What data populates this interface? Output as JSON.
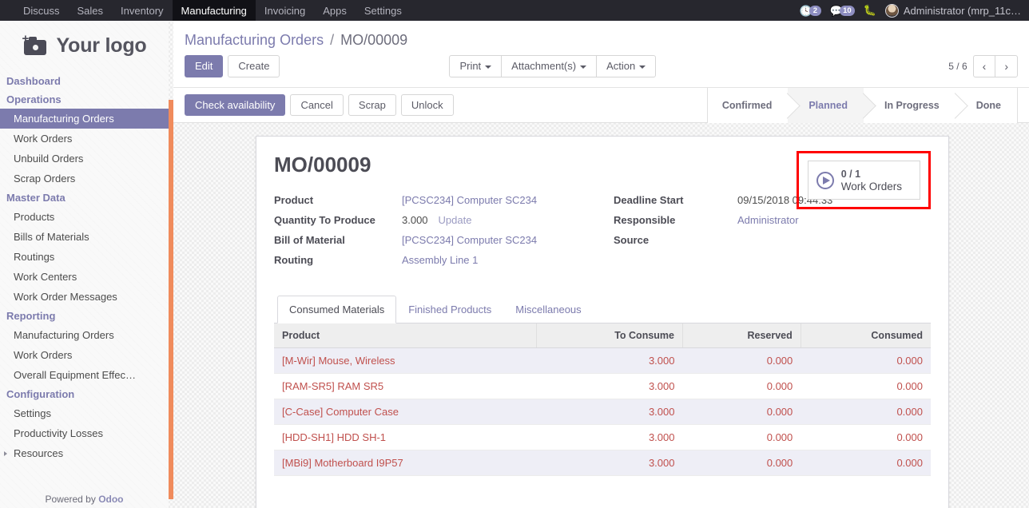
{
  "navbar": {
    "items": [
      {
        "label": "Discuss",
        "active": false
      },
      {
        "label": "Sales",
        "active": false
      },
      {
        "label": "Inventory",
        "active": false
      },
      {
        "label": "Manufacturing",
        "active": true
      },
      {
        "label": "Invoicing",
        "active": false
      },
      {
        "label": "Apps",
        "active": false
      },
      {
        "label": "Settings",
        "active": false
      }
    ],
    "activity_count": "2",
    "messages_count": "10",
    "user_name": "Administrator (mrp_11c…"
  },
  "sidebar": {
    "logo_text": "Your logo",
    "sections": [
      {
        "header": "Dashboard",
        "items": []
      },
      {
        "header": "Operations",
        "items": [
          {
            "label": "Manufacturing Orders",
            "active": true,
            "expandable": false
          },
          {
            "label": "Work Orders",
            "active": false,
            "expandable": false
          },
          {
            "label": "Unbuild Orders",
            "active": false,
            "expandable": false
          },
          {
            "label": "Scrap Orders",
            "active": false,
            "expandable": false
          }
        ]
      },
      {
        "header": "Master Data",
        "items": [
          {
            "label": "Products",
            "active": false,
            "expandable": false
          },
          {
            "label": "Bills of Materials",
            "active": false,
            "expandable": false
          },
          {
            "label": "Routings",
            "active": false,
            "expandable": false
          },
          {
            "label": "Work Centers",
            "active": false,
            "expandable": false
          },
          {
            "label": "Work Order Messages",
            "active": false,
            "expandable": false
          }
        ]
      },
      {
        "header": "Reporting",
        "items": [
          {
            "label": "Manufacturing Orders",
            "active": false,
            "expandable": false
          },
          {
            "label": "Work Orders",
            "active": false,
            "expandable": false
          },
          {
            "label": "Overall Equipment Effec…",
            "active": false,
            "expandable": false
          }
        ]
      },
      {
        "header": "Configuration",
        "items": [
          {
            "label": "Settings",
            "active": false,
            "expandable": false
          },
          {
            "label": "Productivity Losses",
            "active": false,
            "expandable": false
          },
          {
            "label": "Resources",
            "active": false,
            "expandable": true
          }
        ]
      }
    ],
    "powered_prefix": "Powered by ",
    "powered_brand": "Odoo"
  },
  "control_panel": {
    "breadcrumb_root": "Manufacturing Orders",
    "breadcrumb_sep": "/",
    "breadcrumb_current": "MO/00009",
    "edit_label": "Edit",
    "create_label": "Create",
    "print_label": "Print",
    "attachments_label": "Attachment(s)",
    "action_label": "Action",
    "pager_text": "5 / 6",
    "prev_glyph": "‹",
    "next_glyph": "›"
  },
  "statusbar": {
    "buttons": [
      {
        "label": "Check availability",
        "primary": true
      },
      {
        "label": "Cancel",
        "primary": false
      },
      {
        "label": "Scrap",
        "primary": false
      },
      {
        "label": "Unlock",
        "primary": false
      }
    ],
    "stages": [
      {
        "label": "Confirmed",
        "active": false
      },
      {
        "label": "Planned",
        "active": true
      },
      {
        "label": "In Progress",
        "active": false
      },
      {
        "label": "Done",
        "active": false
      }
    ]
  },
  "form": {
    "title": "MO/00009",
    "stat_button": {
      "value": "0 / 1",
      "label": "Work Orders",
      "icon": "play-circle-icon",
      "highlight_color": "#ff0000"
    },
    "left_fields": [
      {
        "label": "Product",
        "value": "[PCSC234] Computer SC234",
        "type": "link"
      },
      {
        "label": "Quantity To Produce",
        "value": "3.000",
        "type": "text",
        "extra": "Update"
      },
      {
        "label": "Bill of Material",
        "value": "[PCSC234] Computer SC234",
        "type": "link"
      },
      {
        "label": "Routing",
        "value": "Assembly Line 1",
        "type": "link"
      }
    ],
    "right_fields": [
      {
        "label": "Deadline Start",
        "value": "09/15/2018 09:44:33",
        "type": "text"
      },
      {
        "label": "Responsible",
        "value": "Administrator",
        "type": "link"
      },
      {
        "label": "Source",
        "value": "",
        "type": "text"
      }
    ]
  },
  "notebook": {
    "tabs": [
      {
        "label": "Consumed Materials",
        "active": true
      },
      {
        "label": "Finished Products",
        "active": false
      },
      {
        "label": "Miscellaneous",
        "active": false
      }
    ],
    "table": {
      "columns": [
        "Product",
        "To Consume",
        "Reserved",
        "Consumed"
      ],
      "rows": [
        {
          "product": "[M-Wir] Mouse, Wireless",
          "to_consume": "3.000",
          "reserved": "0.000",
          "consumed": "0.000"
        },
        {
          "product": "[RAM-SR5] RAM SR5",
          "to_consume": "3.000",
          "reserved": "0.000",
          "consumed": "0.000"
        },
        {
          "product": "[C-Case] Computer Case",
          "to_consume": "3.000",
          "reserved": "0.000",
          "consumed": "0.000"
        },
        {
          "product": "[HDD-SH1] HDD SH-1",
          "to_consume": "3.000",
          "reserved": "0.000",
          "consumed": "0.000"
        },
        {
          "product": "[MBi9] Motherboard I9P57",
          "to_consume": "3.000",
          "reserved": "0.000",
          "consumed": "0.000"
        }
      ]
    }
  },
  "theme": {
    "accent": "#7c7bad",
    "navbar_bg": "#27272e",
    "scrollbar": "#f08b5c",
    "row_value": "#c0504d"
  }
}
